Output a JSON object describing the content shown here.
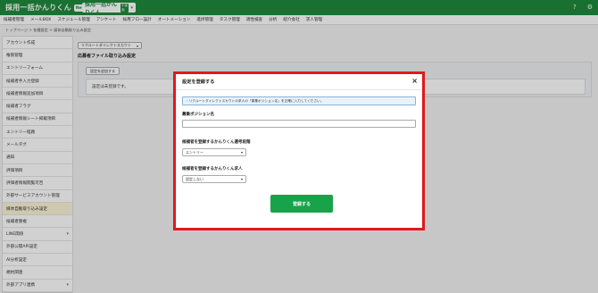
{
  "header": {
    "logo_text": "採用一括かんりくん",
    "logo_badge": "New卒・中途",
    "product_switch_label": "採用一括かんりくん",
    "product_switch_tag": "中途版",
    "icons": [
      "help-icon",
      "settings-icon"
    ]
  },
  "menu": [
    "候補者管理",
    "メールBOX",
    "スケジュール管理",
    "アンケート",
    "採用フロー設計",
    "オートメーション",
    "進捗管理",
    "タスク管理",
    "適性検査",
    "分析",
    "紹介会社",
    "求人管理"
  ],
  "breadcrumb": "トップページ > 各種設定 > 媒体自動取り込み設定",
  "sidebar": {
    "items": [
      {
        "label": "アカウント作成"
      },
      {
        "label": "権限管理"
      },
      {
        "label": "エントリーフォーム"
      },
      {
        "label": "候補者手入力登録"
      },
      {
        "label": "候補者情報追加項目"
      },
      {
        "label": "候補者フラグ"
      },
      {
        "label": "候補者情報シート掲載項目"
      },
      {
        "label": "エントリー経路"
      },
      {
        "label": "メールタグ"
      },
      {
        "label": "通知"
      },
      {
        "label": "評価項目"
      },
      {
        "label": "評価者情報閲覧可否"
      },
      {
        "label": "外部サービスアカウント管理"
      },
      {
        "label": "媒体自動取り込み設定"
      },
      {
        "label": "候補者重複"
      },
      {
        "label": "LINE関係"
      },
      {
        "label": "外部公開API設定"
      },
      {
        "label": "AI分析設定"
      },
      {
        "label": "規約関連"
      },
      {
        "label": "外部アプリ連携"
      }
    ]
  },
  "main": {
    "source_select": "リクルートダイレクトスカウト",
    "title": "応募者ファイル取り込み設定",
    "add_button": "設定を追加する",
    "empty_text": "設定は未登録です。"
  },
  "modal": {
    "title": "設定を登録する",
    "close": "×",
    "info": "・リクルートダイレクトスカウトの求人の「募集ポジション名」を正確に入力してください。",
    "position_label": "募集ポジション名",
    "position_value": "",
    "stage_label": "候補者を登録するかんりくん選考段階",
    "stage_value": "エントリー",
    "job_label": "候補者を登録するかんりくん求人",
    "job_value": "設定しない",
    "submit": "登録する"
  }
}
